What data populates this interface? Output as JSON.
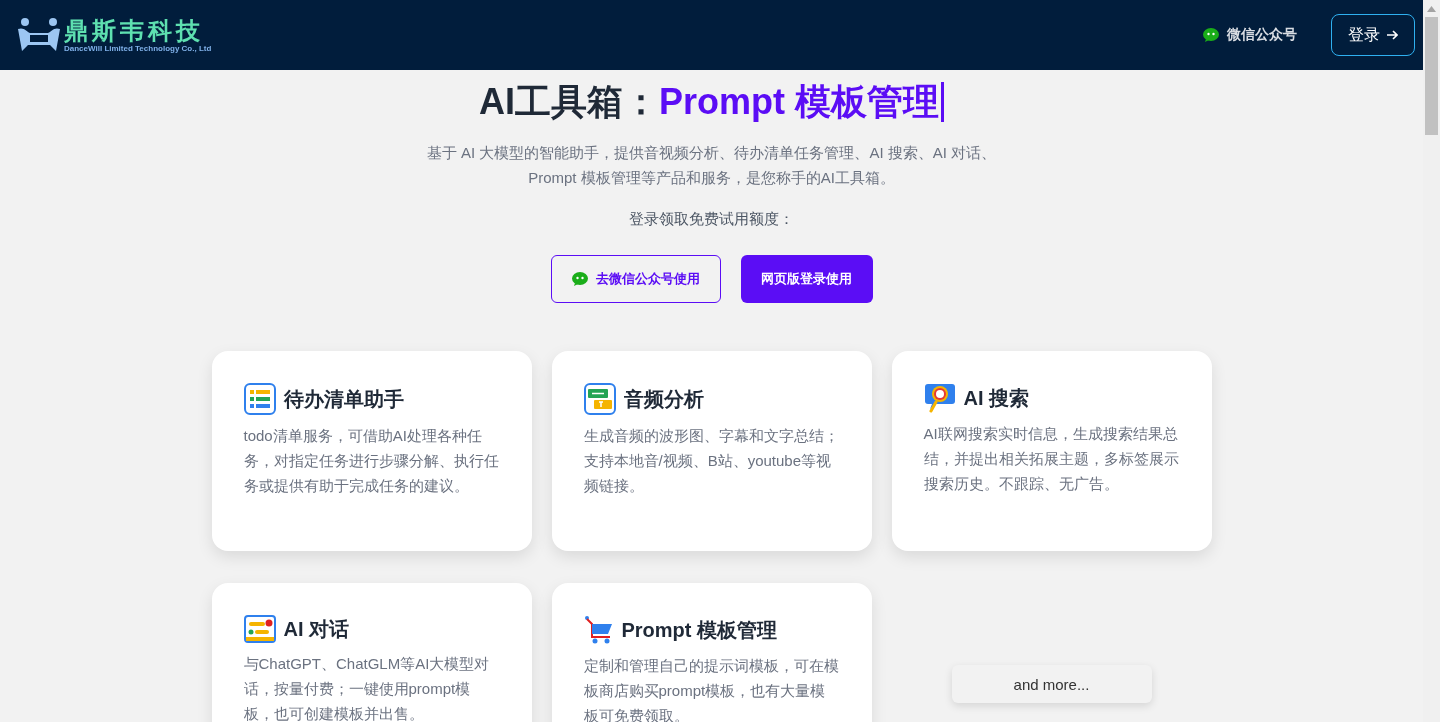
{
  "header": {
    "logo_title": "鼎斯韦科技",
    "logo_subtitle": "DanceWill Limited Technology Co., Ltd",
    "wechat_link": "微信公众号",
    "login_button": "登录"
  },
  "hero": {
    "title_prefix": "AI工具箱：",
    "title_highlight": "Prompt 模板管理",
    "description": "基于 AI 大模型的智能助手，提供音视频分析、待办清单任务管理、AI 搜索、AI 对话、Prompt 模板管理等产品和服务，是您称手的AI工具箱。",
    "trial_note": "登录领取免费试用额度：",
    "wechat_button": "去微信公众号使用",
    "web_button": "网页版登录使用"
  },
  "cards": [
    {
      "kind": "todo",
      "title": "待办清单助手",
      "text": "todo清单服务，可借助AI处理各种任务，对指定任务进行步骤分解、执行任务或提供有助于完成任务的建议。"
    },
    {
      "kind": "audio",
      "title": "音频分析",
      "text": "生成音频的波形图、字幕和文字总结；支持本地音/视频、B站、youtube等视频链接。"
    },
    {
      "kind": "search",
      "title": "AI 搜索",
      "text": "AI联网搜索实时信息，生成搜索结果总结，并提出相关拓展主题，多标签展示搜索历史。不跟踪、无广告。"
    },
    {
      "kind": "chat",
      "title": "AI 对话",
      "text": "与ChatGPT、ChatGLM等AI大模型对话，按量付费；一键使用prompt模板，也可创建模板并出售。"
    },
    {
      "kind": "cart",
      "title": "Prompt 模板管理",
      "text": "定制和管理自己的提示词模板，可在模板商店购买prompt模板，也有大量模板可免费领取。"
    }
  ],
  "more_button": "and more..."
}
